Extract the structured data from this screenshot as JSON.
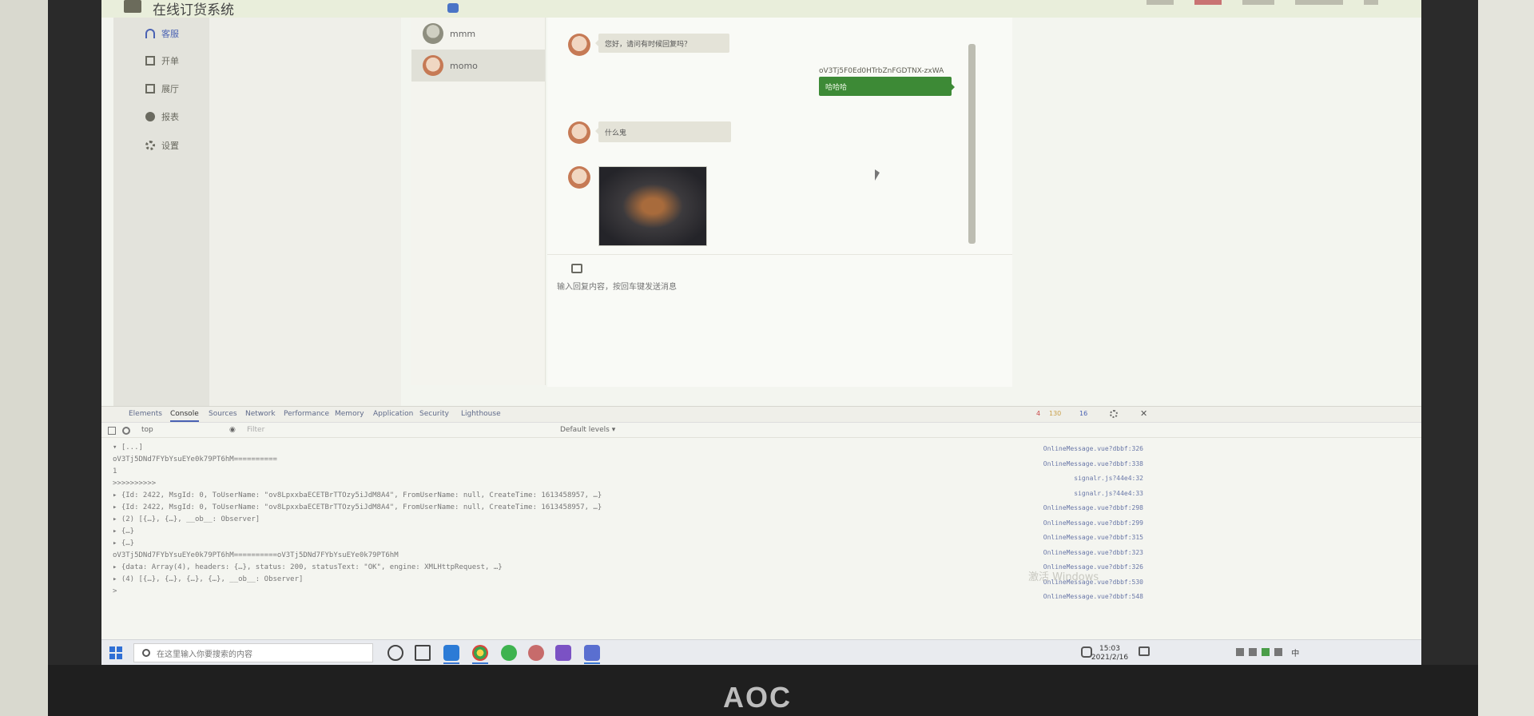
{
  "monitor": {
    "brand": "AOC"
  },
  "app": {
    "title": "在线订货系统",
    "nav": [
      {
        "label": "客服",
        "icon": "headset-icon"
      },
      {
        "label": "开单",
        "icon": "list-icon"
      },
      {
        "label": "展厅",
        "icon": "plus-box-icon"
      },
      {
        "label": "报表",
        "icon": "chart-icon"
      },
      {
        "label": "设置",
        "icon": "gear-icon"
      }
    ]
  },
  "contacts": [
    {
      "name": "mmm"
    },
    {
      "name": "momo"
    }
  ],
  "chat": {
    "messages": [
      {
        "side": "left",
        "text": "您好，请问有时候回复吗？"
      },
      {
        "side": "right",
        "sender": "oV3Tj5F0Ed0HTrbZnFGDTNX-zxWA",
        "text": "哈哈哈"
      },
      {
        "side": "left",
        "text": "什么鬼"
      },
      {
        "side": "left",
        "type": "image"
      }
    ],
    "input_placeholder": "输入回复内容，按回车键发送消息"
  },
  "devtools": {
    "tabs": [
      "Elements",
      "Console",
      "Sources",
      "Network",
      "Performance",
      "Memory",
      "Application",
      "Security",
      "Lighthouse"
    ],
    "active_tab": "Console",
    "badges": {
      "errors": "4",
      "warnings": "130",
      "messages": "16"
    },
    "context": "top",
    "filter_placeholder": "Filter",
    "levels": "Default levels ▾",
    "lines": [
      "▾ [...]",
      "oV3Tj5DNd7FYbYsuEYe0k79PT6hM==========",
      "1",
      ">>>>>>>>>>",
      "▸ {Id: 2422, MsgId: 0, ToUserName: \"ov8LpxxbaECETBrTTOzy5iJdM8A4\", FromUserName: null, CreateTime: 1613458957, …}",
      "▸ {Id: 2422, MsgId: 0, ToUserName: \"ov8LpxxbaECETBrTTOzy5iJdM8A4\", FromUserName: null, CreateTime: 1613458957, …}",
      "▸ (2) [{…}, {…}, __ob__: Observer]",
      "▸ {…}",
      "▸ {…}",
      "oV3Tj5DNd7FYbYsuEYe0k79PT6hM==========oV3Tj5DNd7FYbYsuEYe0k79PT6hM",
      "▸ {data: Array(4), headers: {…}, status: 200, statusText: \"OK\", engine: XMLHttpRequest, …}",
      "▸ (4) [{…}, {…}, {…}, {…}, __ob__: Observer]",
      ">"
    ],
    "links": [
      "OnlineMessage.vue?dbbf:326",
      "OnlineMessage.vue?dbbf:338",
      "signalr.js?44e4:32",
      "signalr.js?44e4:33",
      "OnlineMessage.vue?dbbf:298",
      "OnlineMessage.vue?dbbf:299",
      "OnlineMessage.vue?dbbf:315",
      "OnlineMessage.vue?dbbf:323",
      "OnlineMessage.vue?dbbf:326",
      "OnlineMessage.vue?dbbf:530",
      "OnlineMessage.vue?dbbf:548"
    ],
    "watermark": "激活 Windows"
  },
  "taskbar": {
    "search_placeholder": "在这里输入你要搜索的内容",
    "tray_ime": "中",
    "time": "15:03",
    "date": "2021/2/16"
  }
}
